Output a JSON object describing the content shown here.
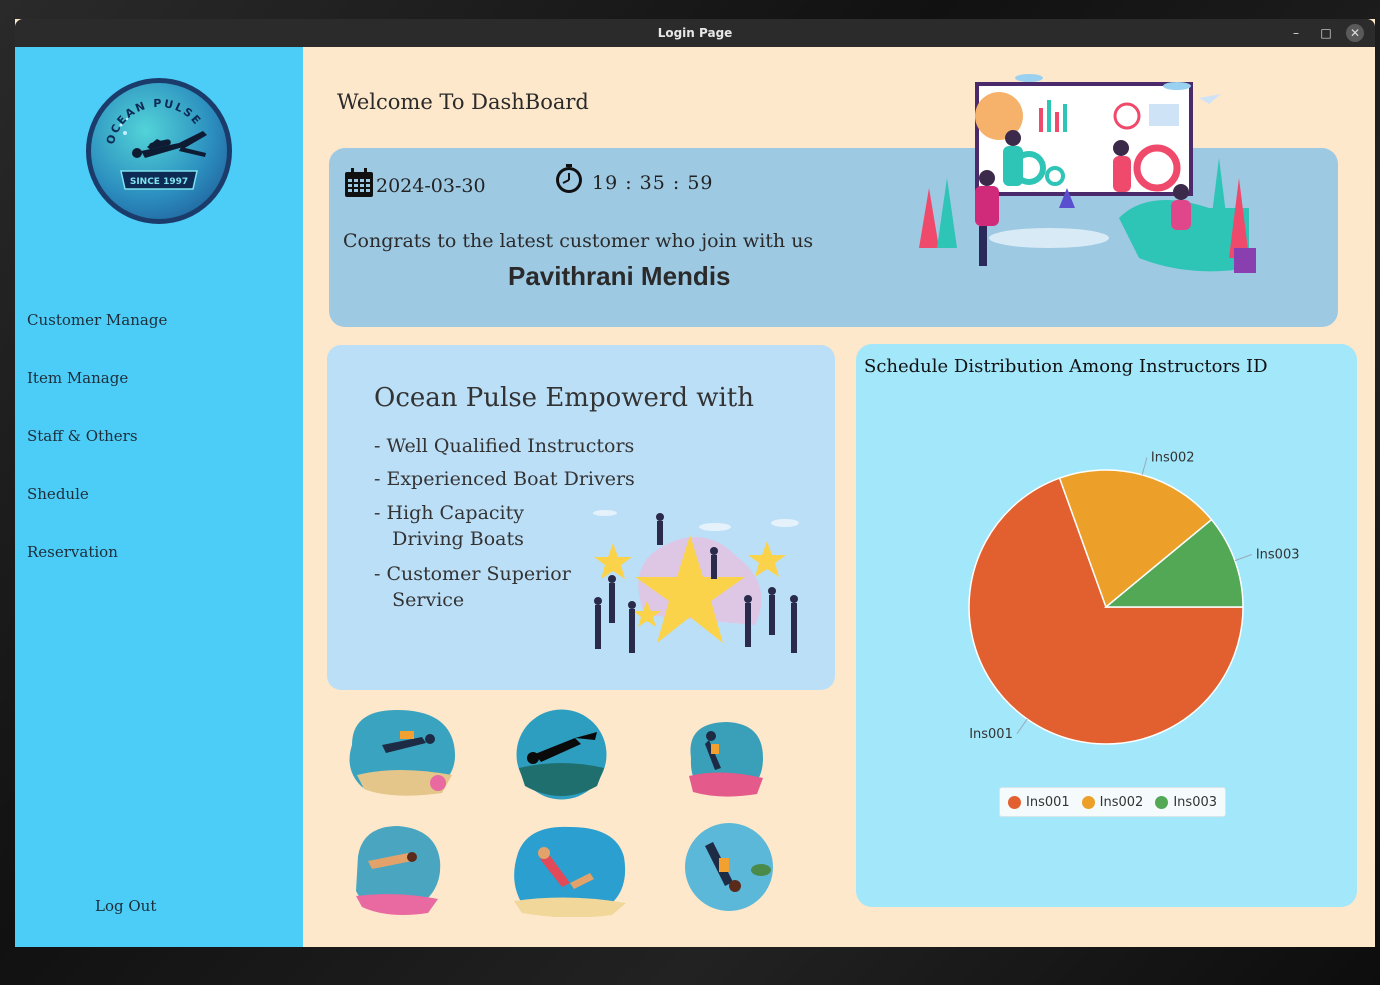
{
  "window": {
    "title": "Login Page",
    "controls": [
      "–",
      "□",
      "✕"
    ]
  },
  "sidebar": {
    "items": [
      {
        "label": "Customer Manage"
      },
      {
        "label": "Item Manage"
      },
      {
        "label": "Staff & Others"
      },
      {
        "label": "Shedule"
      },
      {
        "label": "Reservation"
      }
    ],
    "logout_label": "Log Out",
    "logo_icon": "ocean-pulse-logo",
    "logo_text_top": "OCEAN PULSE",
    "logo_text_bottom": "SINCE 1997"
  },
  "main": {
    "welcome": "Welcome To DashBoard",
    "banner": {
      "date": "2024-03-30",
      "time": "19 : 35 : 59",
      "congrats": "Congrats to the latest customer who join with us",
      "customer_name": "Pavithrani Mendis"
    },
    "empower": {
      "title": "Ocean Pulse Empowerd with",
      "items": [
        "- Well Qualified Instructors",
        "- Experienced Boat Drivers",
        "- High Capacity\n   Driving Boats",
        "- Customer Superior\n   Service"
      ]
    }
  },
  "chart_data": {
    "type": "pie",
    "title": "Schedule Distribution Among Instructors ID",
    "categories": [
      "Ins001",
      "Ins002",
      "Ins003"
    ],
    "values": [
      69.5,
      19.5,
      11
    ],
    "colors": [
      "#e2602f",
      "#eca02a",
      "#52a855"
    ],
    "legend_position": "bottom"
  }
}
